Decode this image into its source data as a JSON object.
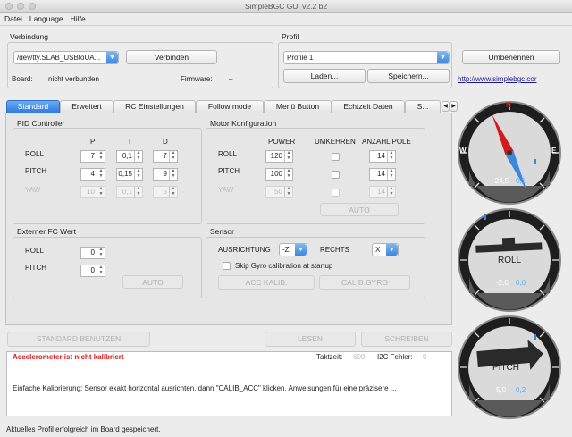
{
  "window": {
    "title": "SimpleBGC GUI v2.2 b2"
  },
  "menu": [
    "Datei",
    "Language",
    "Hilfe"
  ],
  "connection": {
    "group_title": "Verbindung",
    "port_value": "/dev/tty.SLAB_USBtoUA...",
    "connect_label": "Verbinden",
    "board_label": "Board:",
    "board_value": "nicht verbunden",
    "firmware_label": "Firmware:",
    "firmware_value": "–"
  },
  "profile": {
    "group_title": "Profil",
    "profile_value": "Profile 1",
    "rename_label": "Umbenennen",
    "load_label": "Laden...",
    "save_label": "Speichern...",
    "link_text": "http://www.simplebgc.cor"
  },
  "tabs": [
    "Standard",
    "Erweitert",
    "RC Einstellungen",
    "Follow mode",
    "Menü Button",
    "Echtzeit Daten",
    "S..."
  ],
  "pid": {
    "title": "PID Controller",
    "headers": [
      "P",
      "I",
      "D"
    ],
    "rows": [
      {
        "label": "ROLL",
        "p": "7",
        "i": "0,1",
        "d": "7"
      },
      {
        "label": "PITCH",
        "p": "4",
        "i": "0,15",
        "d": "9"
      },
      {
        "label": "YAW",
        "p": "10",
        "i": "0,1",
        "d": "5"
      }
    ]
  },
  "motor": {
    "title": "Motor Konfiguration",
    "headers": [
      "POWER",
      "UMKEHREN",
      "ANZAHL POLE"
    ],
    "rows": [
      {
        "label": "ROLL",
        "power": "120",
        "poles": "14"
      },
      {
        "label": "PITCH",
        "power": "100",
        "poles": "14"
      },
      {
        "label": "YAW",
        "power": "50",
        "poles": "14"
      }
    ],
    "auto_label": "AUTO"
  },
  "external_fc": {
    "title": "Externer FC Wert",
    "rows": [
      {
        "label": "ROLL",
        "value": "0"
      },
      {
        "label": "PITCH",
        "value": "0"
      }
    ],
    "auto_label": "AUTO"
  },
  "sensor": {
    "title": "Sensor",
    "orientation_label": "AUSRICHTUNG",
    "orientation_value": "-Z",
    "right_label": "RECHTS",
    "right_value": "X",
    "skip_gyro_label": "Skip Gyro calibration at startup",
    "acc_calib_label": "ACC KALIB.",
    "gyro_calib_label": "CALIB.GYRO"
  },
  "actions": {
    "defaults_label": "STANDARD BENUTZEN",
    "read_label": "LESEN",
    "write_label": "SCHREIBEN"
  },
  "log": {
    "warning": "Accelerometer ist nicht kalibriert",
    "cycle_label": "Taktzeit:",
    "cycle_value": "609",
    "i2c_label": "I2C Fehler:",
    "i2c_value": "0",
    "message": "Einfache Kalibrierung: Sensor exakt horizontal ausrichten, dann \"CALIB_ACC\" klicken. Anweisungen für eine präzisere ..."
  },
  "status": {
    "text": "Aktuelles Profil erfolgreich im Board gespeichert."
  },
  "gauges": {
    "compass": {
      "north_label": "N",
      "east_label": "E",
      "west_label": "W",
      "value": "-24,5",
      "rate": "0,1",
      "heading_deg": -24.5
    },
    "roll": {
      "label": "ROLL",
      "value": "-2,6",
      "rate": "0,0",
      "angle_deg": -2.6
    },
    "pitch": {
      "label": "PITCH",
      "value": "5,0",
      "rate": "0,2",
      "angle_deg": 5.0
    }
  },
  "colors": {
    "accent": "#3d86df",
    "warning": "#d21a1a",
    "gauge_value": "#5ab0ff",
    "north": "#d21a1a"
  }
}
